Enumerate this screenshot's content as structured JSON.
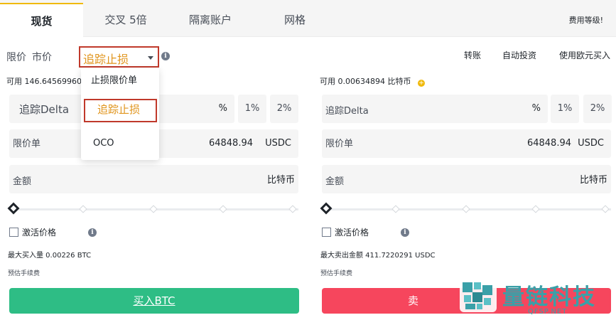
{
  "tabs": [
    {
      "label": "现货",
      "active": true
    },
    {
      "label": "交叉 5倍"
    },
    {
      "label": "隔离账户"
    },
    {
      "label": "网格"
    }
  ],
  "fee_link": "费用等级!",
  "order_types": {
    "limit": "限价",
    "market": "市价"
  },
  "dropdown": {
    "selected": "追踪止损",
    "options": [
      "止损限价单",
      "追踪止损",
      "OCO"
    ]
  },
  "top_links": [
    "转账",
    "自动投资",
    "使用欧元买入"
  ],
  "buy": {
    "available": "可用 146.64569960",
    "trailing_label": "追踪Delta",
    "trailing_unit": "%",
    "pct1": "1%",
    "pct2": "2%",
    "limit_label": "限价单",
    "limit_value": "64848.94",
    "limit_unit": "USDC",
    "amount_label": "金额",
    "amount_unit": "比特币",
    "activate_label": "激活价格",
    "max_label": "最大买入量 0.00226 BTC",
    "fee_label": "预估手续费",
    "button": "买入BTC"
  },
  "sell": {
    "available": "可用 0.00634894 比特币",
    "trailing_label": "追踪Delta",
    "trailing_unit": "%",
    "pct1": "1%",
    "pct2": "2%",
    "limit_label": "限价单",
    "limit_value": "64848.94",
    "limit_unit": "USDC",
    "amount_label": "金额",
    "amount_unit": "比特币",
    "activate_label": "激活价格",
    "max_label": "最大卖出金额 411.7220291 USDC",
    "fee_label": "预估手续费",
    "button": "卖"
  },
  "watermark": {
    "title": "量链科技",
    "sub": "QFSP.NET"
  },
  "colors": {
    "accent": "#f0b90b",
    "buy": "#2ebd85",
    "sell": "#f6465d",
    "highlight": "#e0941b",
    "annotation": "#c0392b"
  }
}
